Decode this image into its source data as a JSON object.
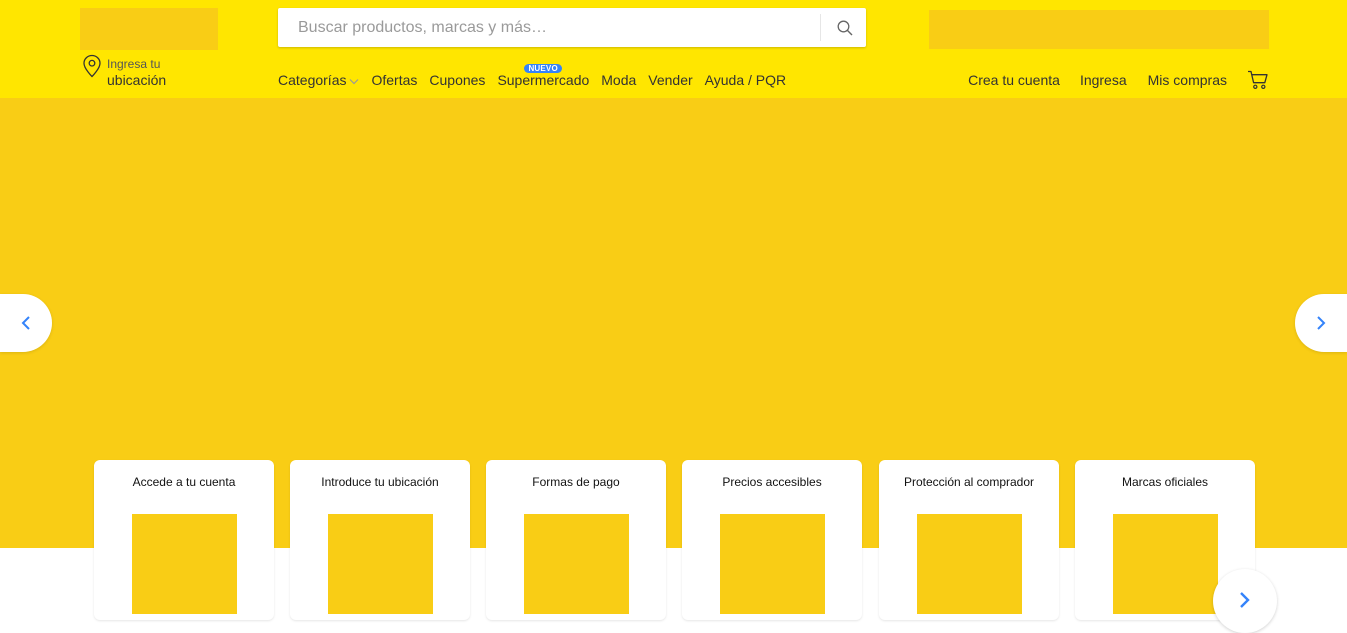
{
  "header": {
    "search": {
      "placeholder": "Buscar productos, marcas y más…",
      "value": ""
    },
    "location": {
      "line1": "Ingresa tu",
      "line2": "ubicación"
    },
    "nav": [
      {
        "label": "Categorías",
        "has_dropdown": true
      },
      {
        "label": "Ofertas"
      },
      {
        "label": "Cupones"
      },
      {
        "label": "Supermercado",
        "badge": "NUEVO"
      },
      {
        "label": "Moda"
      },
      {
        "label": "Vender"
      },
      {
        "label": "Ayuda / PQR"
      }
    ],
    "user_links": [
      "Crea tu cuenta",
      "Ingresa",
      "Mis compras"
    ]
  },
  "cards": [
    {
      "title": "Accede a tu cuenta"
    },
    {
      "title": "Introduce tu ubicación"
    },
    {
      "title": "Formas de pago"
    },
    {
      "title": "Precios accesibles"
    },
    {
      "title": "Protección al comprador"
    },
    {
      "title": "Marcas oficiales"
    }
  ],
  "colors": {
    "header_bg": "#ffe600",
    "placeholder_yellow": "#f9cd15",
    "accent_blue": "#3483fa"
  },
  "icons": [
    "location-pin-icon",
    "search-icon",
    "chevron-down-icon",
    "cart-icon",
    "chevron-left-icon",
    "chevron-right-icon"
  ]
}
